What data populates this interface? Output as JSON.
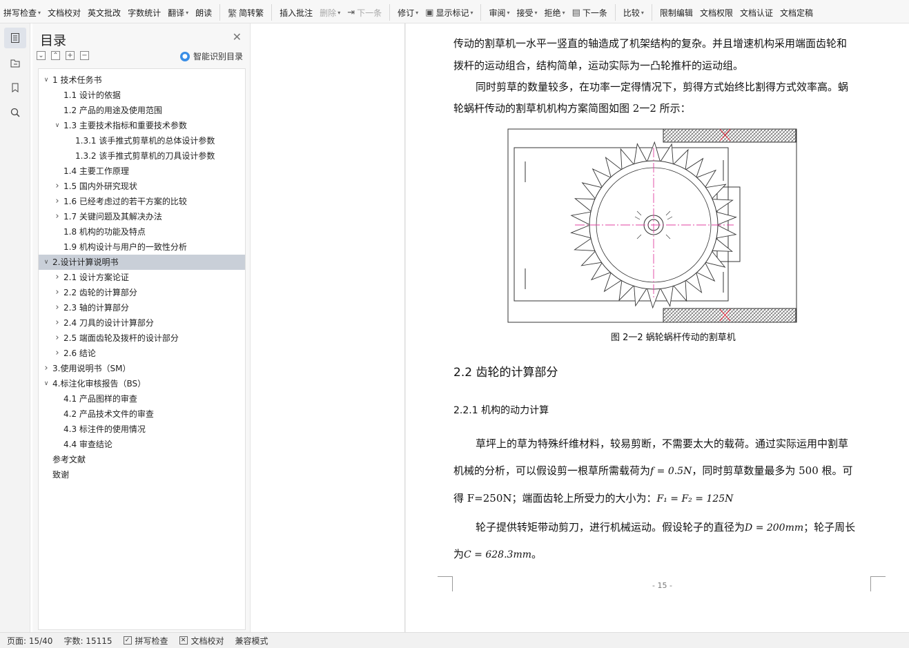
{
  "ribbon": [
    {
      "label": "拼写检查",
      "caret": true,
      "icon": ""
    },
    {
      "label": "文档校对",
      "caret": false,
      "icon": ""
    },
    {
      "label": "英文批改",
      "caret": false,
      "icon": ""
    },
    {
      "label": "字数统计",
      "caret": false,
      "icon": ""
    },
    {
      "label": "翻译",
      "caret": true,
      "icon": ""
    },
    {
      "label": "朗读",
      "caret": false,
      "icon": ""
    },
    {
      "label": "简转繁",
      "caret": false,
      "icon": "繁"
    },
    {
      "label": "插入批注",
      "caret": false,
      "icon": ""
    },
    {
      "label": "删除",
      "caret": true,
      "icon": ""
    },
    {
      "label": "下一条",
      "caret": false,
      "icon": "⇥"
    },
    {
      "label": "修订",
      "caret": true,
      "icon": ""
    },
    {
      "label": "显示标记",
      "caret": true,
      "icon": "▣"
    },
    {
      "label": "审阅",
      "caret": true,
      "icon": ""
    },
    {
      "label": "接受",
      "caret": true,
      "icon": ""
    },
    {
      "label": "拒绝",
      "caret": true,
      "icon": ""
    },
    {
      "label": "下一条",
      "caret": false,
      "icon": "▤"
    },
    {
      "label": "比较",
      "caret": true,
      "icon": ""
    },
    {
      "label": "限制编辑",
      "caret": false,
      "icon": ""
    },
    {
      "label": "文档权限",
      "caret": false,
      "icon": ""
    },
    {
      "label": "文档认证",
      "caret": false,
      "icon": ""
    },
    {
      "label": "文档定稿",
      "caret": false,
      "icon": ""
    }
  ],
  "toc": {
    "title": "目录",
    "smart_label": "智能识别目录",
    "items": [
      {
        "label": "1  技术任务书",
        "level": 0,
        "state": "expanded"
      },
      {
        "label": "1.1  设计的依据",
        "level": 1,
        "state": "none"
      },
      {
        "label": "1.2 产品的用途及使用范围",
        "level": 1,
        "state": "none"
      },
      {
        "label": "1.3 主要技术指标和重要技术参数",
        "level": 1,
        "state": "expanded"
      },
      {
        "label": "1.3.1  该手推式剪草机的总体设计参数",
        "level": 2,
        "state": "none"
      },
      {
        "label": "1.3.2  该手推式剪草机的刀具设计参数",
        "level": 2,
        "state": "none"
      },
      {
        "label": "1.4 主要工作原理",
        "level": 1,
        "state": "none"
      },
      {
        "label": "1.5 国内外研究现状",
        "level": 1,
        "state": "collapsed"
      },
      {
        "label": "1.6 已经考虑过的若干方案的比较",
        "level": 1,
        "state": "collapsed"
      },
      {
        "label": "1.7 关键问题及其解决办法",
        "level": 1,
        "state": "collapsed"
      },
      {
        "label": "1.8    机构的功能及特点",
        "level": 1,
        "state": "none"
      },
      {
        "label": "1.9 机构设计与用户的一致性分析",
        "level": 1,
        "state": "none"
      },
      {
        "label": "2.设计计算说明书",
        "level": 0,
        "state": "expanded",
        "selected": true
      },
      {
        "label": "2.1  设计方案论证",
        "level": 1,
        "state": "collapsed"
      },
      {
        "label": "2.2  齿轮的计算部分",
        "level": 1,
        "state": "collapsed"
      },
      {
        "label": "2.3  轴的计算部分",
        "level": 1,
        "state": "collapsed"
      },
      {
        "label": "2.4  刀具的设计计算部分",
        "level": 1,
        "state": "collapsed"
      },
      {
        "label": "2.5  端面齿轮及拨杆的设计部分",
        "level": 1,
        "state": "collapsed"
      },
      {
        "label": "2.6  结论",
        "level": 1,
        "state": "collapsed"
      },
      {
        "label": "3.使用说明书（SM）",
        "level": 0,
        "state": "collapsed"
      },
      {
        "label": "4.标注化审核报告（BS）",
        "level": 0,
        "state": "expanded"
      },
      {
        "label": "4.1  产品图样的审查",
        "level": 1,
        "state": "none"
      },
      {
        "label": "4.2 产品技术文件的审查",
        "level": 1,
        "state": "none"
      },
      {
        "label": "4.3  标注件的使用情况",
        "level": 1,
        "state": "none"
      },
      {
        "label": "4.4  审查结论",
        "level": 1,
        "state": "none"
      },
      {
        "label": "参考文献",
        "level": 0,
        "state": "none"
      },
      {
        "label": "致谢",
        "level": 0,
        "state": "none"
      }
    ]
  },
  "doc": {
    "line1": "传动的割草机一水平一竖直的轴造成了机架结构的复杂。并且增速机构采用端面齿轮和",
    "line2": "拨杆的运动组合，结构简单，运动实际为一凸轮推杆的运动组。",
    "line3": "同时剪草的数量较多，在功率一定得情况下，剪得方式始终比割得方式效率高。蜗",
    "line4": "轮蜗杆传动的割草机机构方案简图如图 2一2 所示：",
    "caption": "图 2一2  蜗轮蜗杆传动的割草机",
    "h22": "2.2  齿轮的计算部分",
    "h221": "2.2.1 机构的动力计算",
    "p1a": "草坪上的草为特殊纤维材料，较易剪断，不需要太大的载荷。通过实际运用中割草",
    "p1b_pre": "机械的分析，可以假设剪一根草所需载荷为",
    "p1b_math": "f = 0.5N",
    "p1b_post": "，同时剪草数量最多为 500 根。可",
    "p1c_pre": "得 F=250N；端面齿轮上所受力的大小为：",
    "p1c_math": "F₁ = F₂ = 125N",
    "p2a_pre": "轮子提供转矩带动剪刀，进行机械运动。假设轮子的直径为",
    "p2a_math": "D = 200mm",
    "p2a_post": "；轮子周长",
    "p2b_pre": "为",
    "p2b_math": "C = 628.3mm",
    "p2b_post": "。",
    "pagenum": "- 15 -"
  },
  "status": {
    "page": "页面: 15/40",
    "words": "字数: 15115",
    "spell": "拼写检查",
    "proof": "文档校对",
    "compat": "兼容模式"
  }
}
